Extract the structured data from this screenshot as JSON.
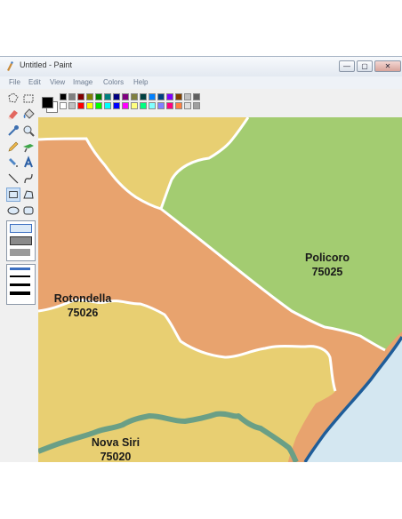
{
  "window": {
    "title": "Untitled - Paint"
  },
  "menu": [
    "File",
    "Edit",
    "View",
    "Image",
    "Colors",
    "Help"
  ],
  "window_buttons": {
    "minimize": "—",
    "maximize": "▢",
    "close": "✕"
  },
  "tools": [
    "free-form-select-icon",
    "select-icon",
    "eraser-icon",
    "fill-bucket-icon",
    "color-picker-icon",
    "magnifier-icon",
    "pencil-icon",
    "brush-icon",
    "airbrush-icon",
    "text-icon",
    "line-icon",
    "curve-icon",
    "rectangle-icon",
    "polygon-icon",
    "ellipse-icon",
    "rounded-rectangle-icon"
  ],
  "palette": {
    "foreground": "#000000",
    "background": "#ffffff",
    "row1": [
      "#000000",
      "#808080",
      "#800000",
      "#808000",
      "#008000",
      "#008080",
      "#000080",
      "#800080",
      "#808040",
      "#004040",
      "#0080ff",
      "#004080",
      "#8000ff",
      "#804000",
      "#c0c0c0",
      "#606060"
    ],
    "row2": [
      "#ffffff",
      "#c0c0c0",
      "#ff0000",
      "#ffff00",
      "#00ff00",
      "#00ffff",
      "#0000ff",
      "#ff00ff",
      "#ffff80",
      "#00ff80",
      "#80ffff",
      "#8080ff",
      "#ff0080",
      "#ff8040",
      "#e0e0e0",
      "#a0a0a0"
    ]
  },
  "map": {
    "colors": {
      "orange": "#e8a36e",
      "green": "#a3cc71",
      "yellow": "#e8cf72",
      "sea": "#d4e7f1",
      "coast": "#1f5d99",
      "river": "#6a9f86"
    },
    "labels": [
      {
        "name": "Policoro",
        "code": "75025"
      },
      {
        "name": "Rotondella",
        "code": "75026"
      },
      {
        "name": "Nova Siri",
        "code": "75020"
      }
    ]
  }
}
